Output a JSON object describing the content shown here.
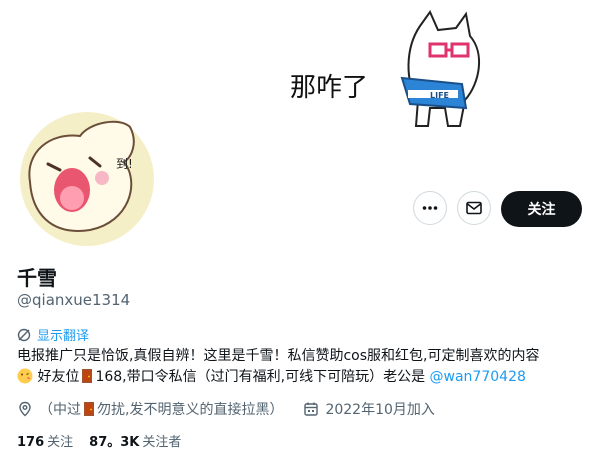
{
  "banner": {
    "caption": "那咋了",
    "shoe_text": "LIFE"
  },
  "actions": {
    "more": "more-options",
    "message": "message",
    "follow_label": "关注"
  },
  "profile": {
    "name": "千雪",
    "handle": "@qianxue1314",
    "translate_label": "显示翻译",
    "bio_line1": "电报推广只是恰饭,真假自辨！这里是千雪！私信赞助cos服和红包,可定制喜欢的内容",
    "bio_line2_a": " 好友位",
    "bio_line2_b": "168,带口令私信（过门有福利,可线下可陪玩）老公是 ",
    "bio_mention": "@wan770428",
    "location_a": "（中过",
    "location_b": "勿扰,发不明意义的直接拉黑）",
    "joined": "2022年10月加入"
  },
  "stats": {
    "following_count": "176",
    "following_label": "关注",
    "followers_count": "87。3K",
    "followers_label": "关注者"
  },
  "colors": {
    "accent": "#1d9bf0",
    "text": "#0f1419",
    "secondary": "#536471",
    "button": "#0f1419"
  }
}
